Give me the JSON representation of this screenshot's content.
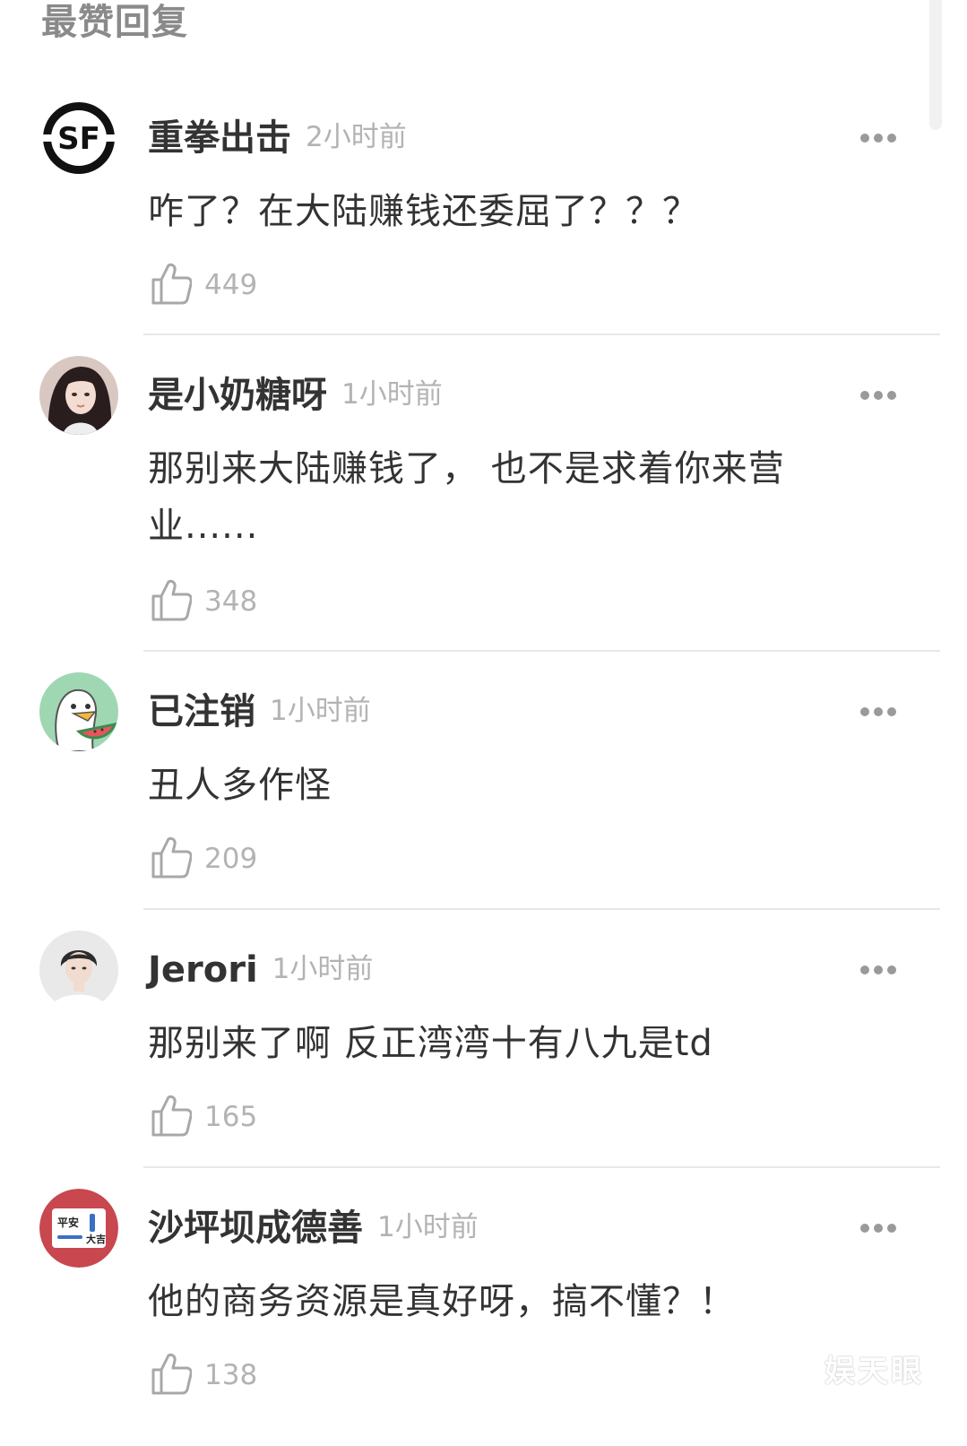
{
  "section_title": "最赞回复",
  "comments": [
    {
      "username": "重拳出击",
      "time": "2小时前",
      "content": "咋了？在大陆赚钱还委屈了？？？",
      "likes": "449",
      "avatar": "sf-logo-avatar"
    },
    {
      "username": "是小奶糖呀",
      "time": "1小时前",
      "content": "那别来大陆赚钱了， 也不是求着你来营业......",
      "likes": "348",
      "avatar": "girl-photo-avatar"
    },
    {
      "username": "已注销",
      "time": "1小时前",
      "content": "丑人多作怪",
      "likes": "209",
      "avatar": "duck-cartoon-avatar"
    },
    {
      "username": "Jerori",
      "time": "1小时前",
      "content": "那别来了啊 反正湾湾十有八九是td",
      "likes": "165",
      "avatar": "man-photo-avatar"
    },
    {
      "username": "沙坪坝成德善",
      "time": "1小时前",
      "content": "他的商务资源是真好呀，搞不懂？！",
      "likes": "138",
      "avatar": "pingan-sticker-avatar",
      "avatar_text": [
        "平安",
        "大吉"
      ]
    }
  ],
  "watermark": "娱天眼",
  "colors": {
    "username": "#333333",
    "meta": "#b3b3b3",
    "divider": "#e8e8e8"
  }
}
